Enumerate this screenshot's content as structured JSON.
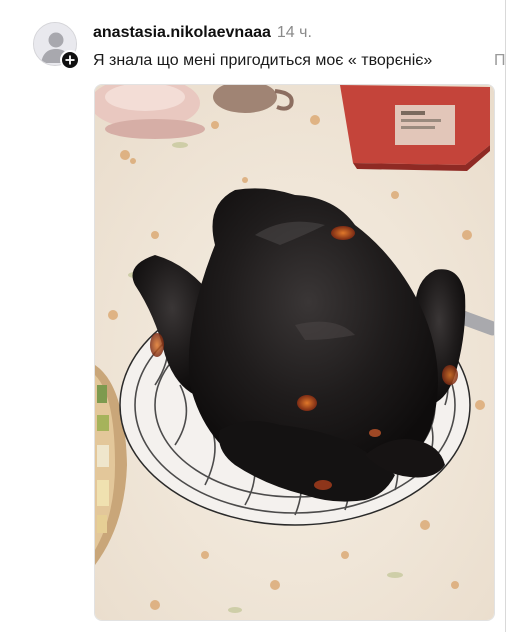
{
  "post": {
    "username": "anastasia.nikolaevnaaa",
    "time": "14 ч.",
    "caption": "Я знала що мені пригодиться моє « творєніє»",
    "translate_hint": "П"
  },
  "icons": {
    "avatar": "default-user-avatar-icon",
    "follow": "plus-icon"
  },
  "colors": {
    "text": "#101010",
    "muted": "#8a8a8a",
    "badge": "#101010"
  }
}
